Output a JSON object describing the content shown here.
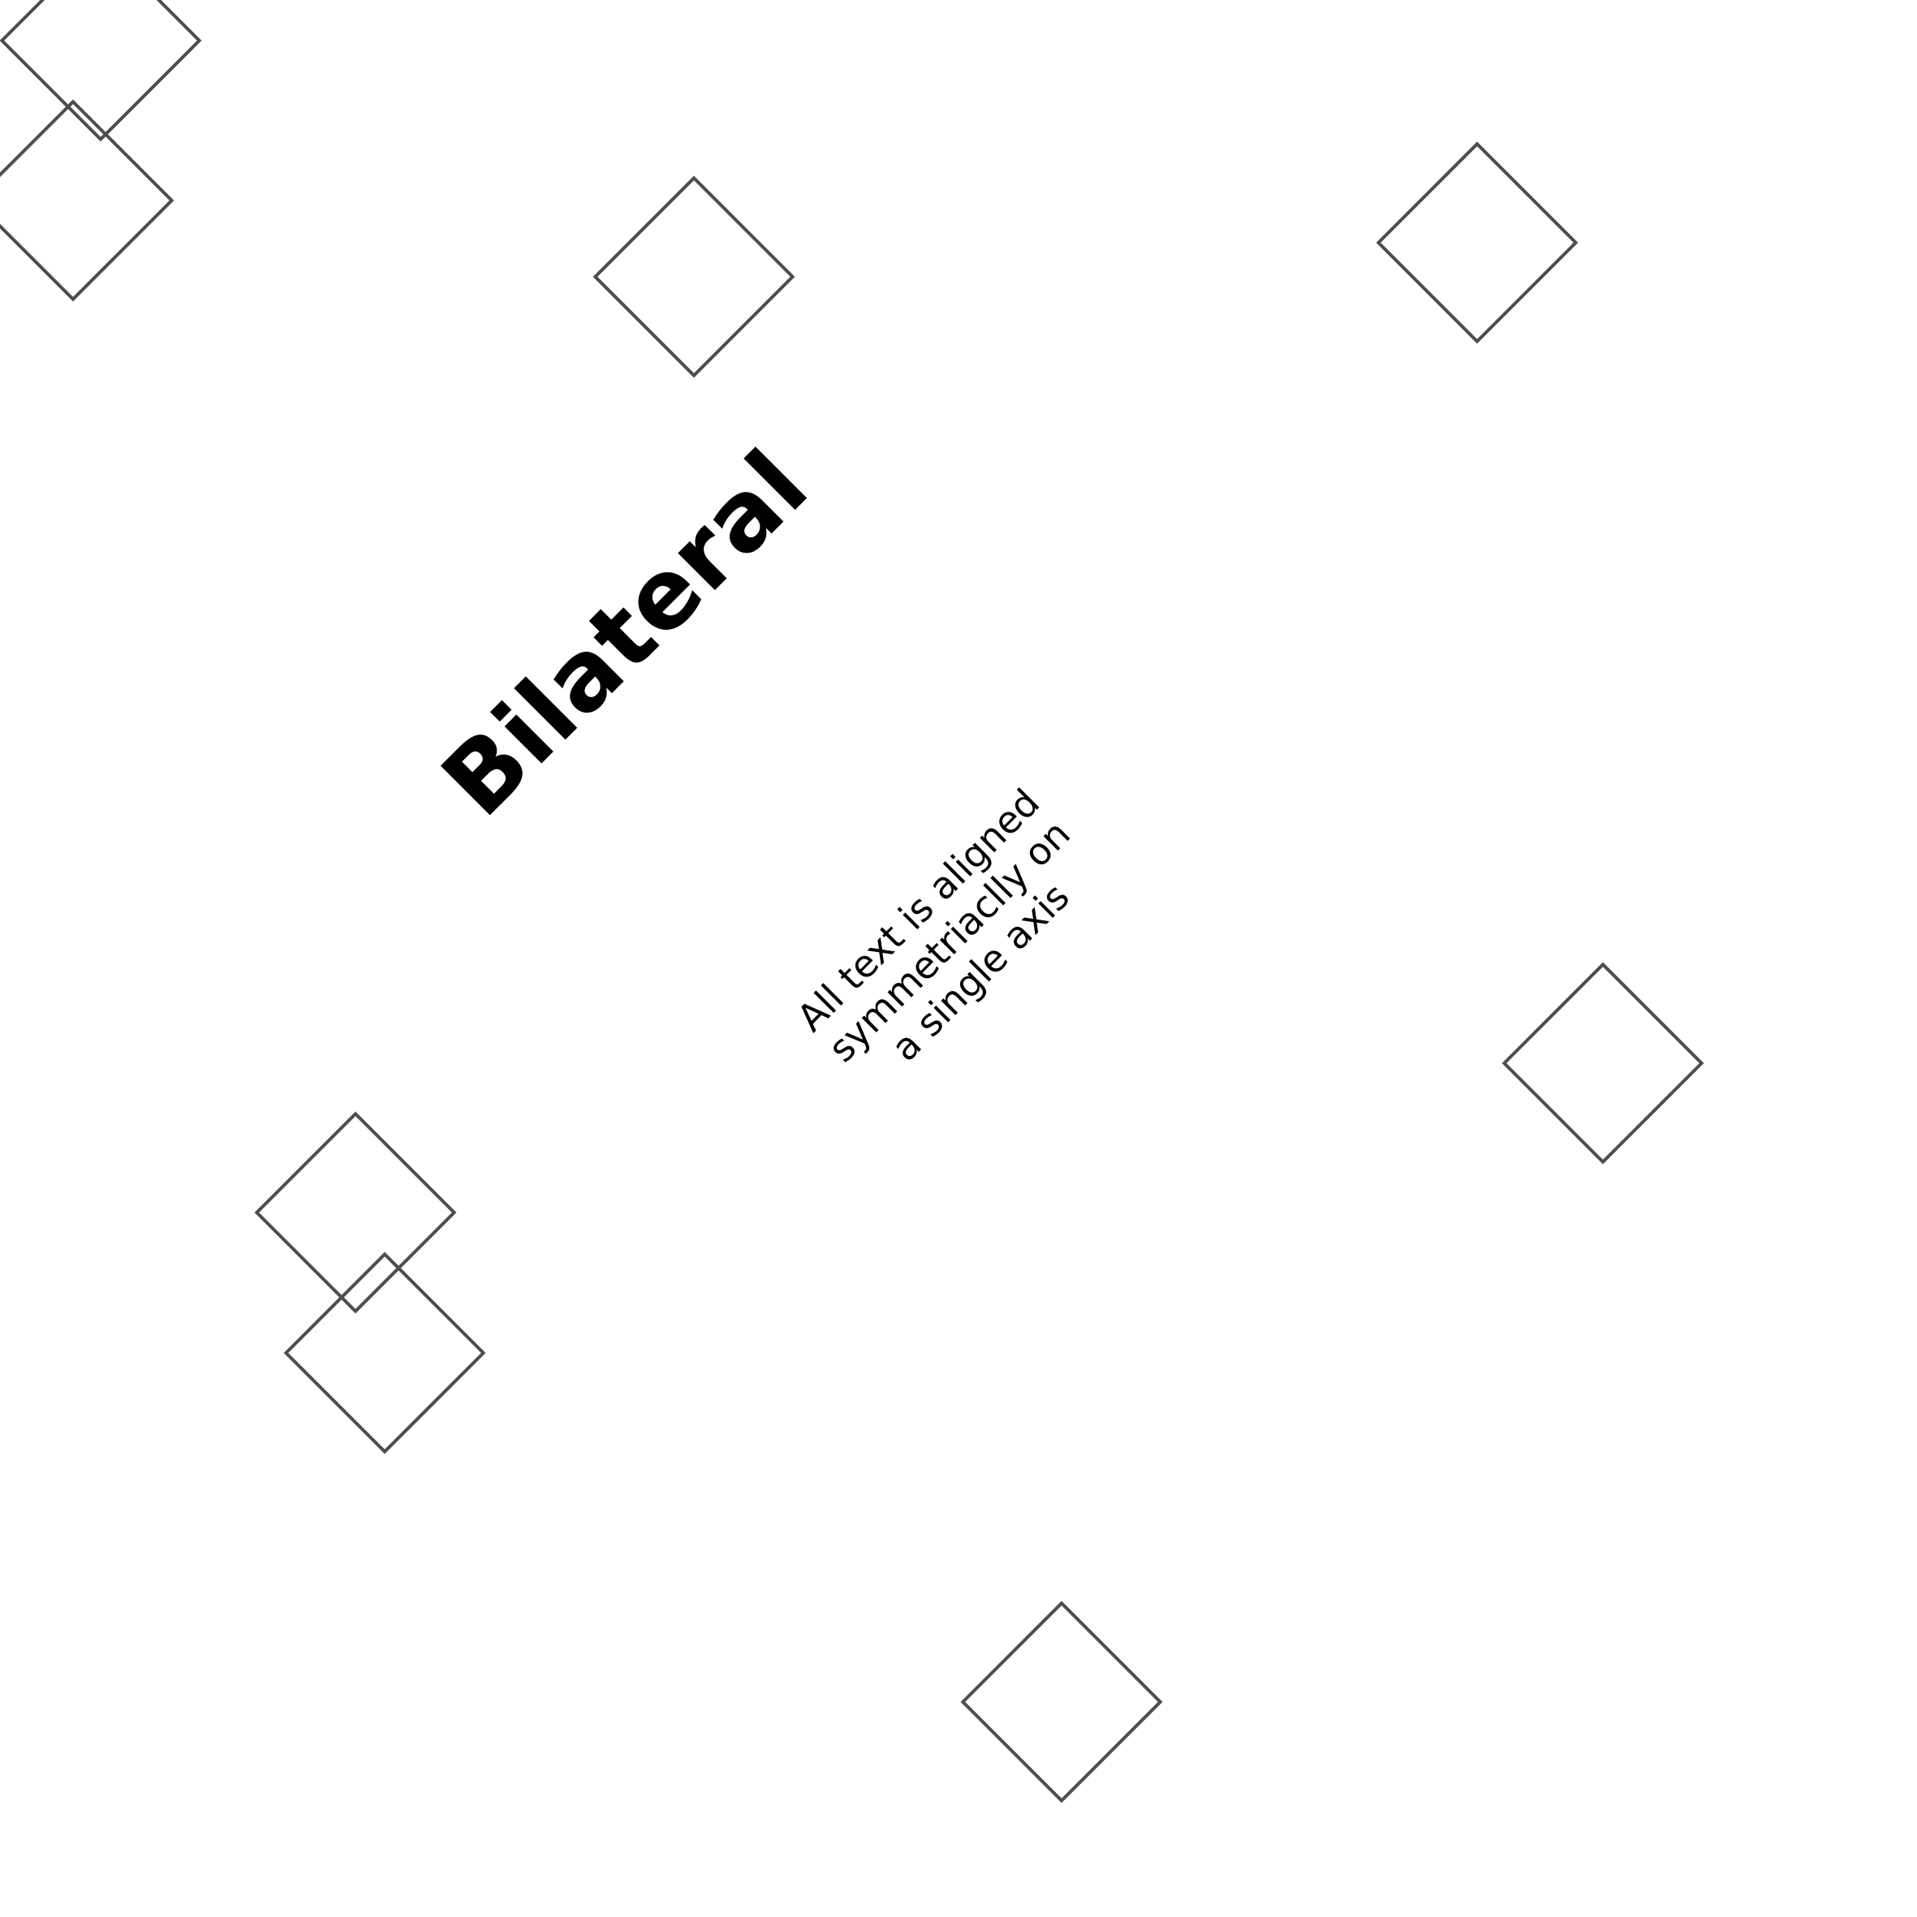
{
  "title": "Bilateral",
  "tagline": {
    "line1": "All text is aligned",
    "line2": "symmetriaclly on",
    "line3": "a single axis"
  },
  "colors": {
    "background": "#ffffff",
    "text": "#000000",
    "diamond_stroke": "#4d4d4d"
  }
}
